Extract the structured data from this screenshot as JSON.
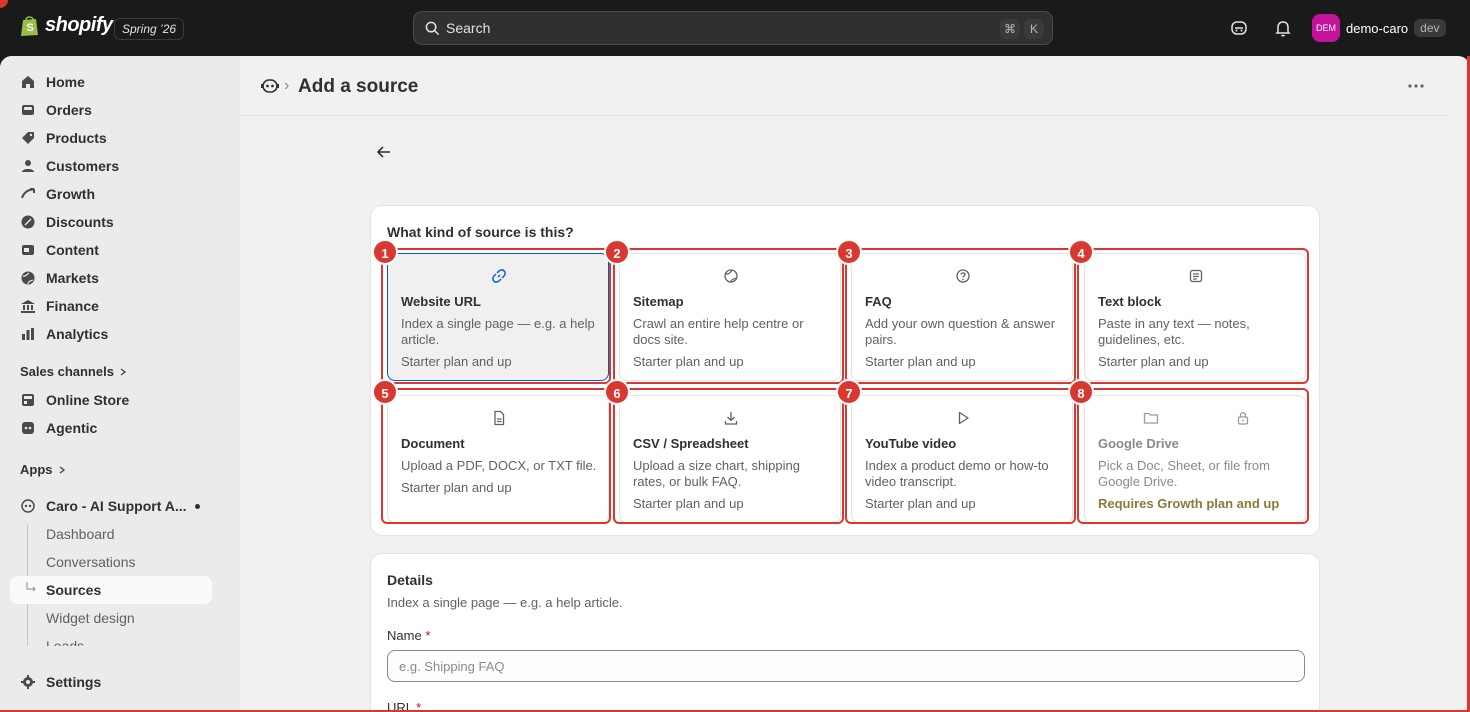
{
  "topbar": {
    "logo_text": "shopify",
    "release_label": "Spring ’26",
    "search_placeholder": "Search",
    "shortcut_keys": [
      "⌘",
      "K"
    ],
    "avatar_initials": "DEM",
    "store_name": "demo-caro",
    "env_badge": "dev"
  },
  "sidebar": {
    "items": [
      {
        "label": "Home",
        "icon": "home-icon"
      },
      {
        "label": "Orders",
        "icon": "inbox-icon"
      },
      {
        "label": "Products",
        "icon": "tag-icon"
      },
      {
        "label": "Customers",
        "icon": "person-icon"
      },
      {
        "label": "Growth",
        "icon": "growth-icon"
      },
      {
        "label": "Discounts",
        "icon": "discount-icon"
      },
      {
        "label": "Content",
        "icon": "content-icon"
      },
      {
        "label": "Markets",
        "icon": "globe-icon"
      },
      {
        "label": "Finance",
        "icon": "bank-icon"
      },
      {
        "label": "Analytics",
        "icon": "bar-chart-icon"
      }
    ],
    "sales_channels_label": "Sales channels",
    "channels": [
      {
        "label": "Online Store",
        "icon": "store-icon"
      },
      {
        "label": "Agentic",
        "icon": "agentic-icon"
      }
    ],
    "apps_label": "Apps",
    "app_name": "Caro - AI Support A...",
    "app_subitems": [
      "Dashboard",
      "Conversations",
      "Sources",
      "Widget design",
      "Leads"
    ],
    "active_subitem": "Sources",
    "settings_label": "Settings"
  },
  "header": {
    "title": "Add a source",
    "crumb_separator": "›"
  },
  "source_picker": {
    "title": "What kind of source is this?",
    "options": [
      {
        "title": "Website URL",
        "desc": "Index a single page — e.g. a help article.",
        "plan": "Starter plan and up",
        "icon": "link-icon",
        "selected": true
      },
      {
        "title": "Sitemap",
        "desc": "Crawl an entire help centre or docs site.",
        "plan": "Starter plan and up",
        "icon": "globe-icon"
      },
      {
        "title": "FAQ",
        "desc": "Add your own question & answer pairs.",
        "plan": "Starter plan and up",
        "icon": "question-circle-icon"
      },
      {
        "title": "Text block",
        "desc": "Paste in any text — notes, guidelines, etc.",
        "plan": "Starter plan and up",
        "icon": "note-icon"
      },
      {
        "title": "Document",
        "desc": "Upload a PDF, DOCX, or TXT file.",
        "plan": "Starter plan and up",
        "icon": "file-icon"
      },
      {
        "title": "CSV / Spreadsheet",
        "desc": "Upload a size chart, shipping rates, or bulk FAQ.",
        "plan": "Starter plan and up",
        "icon": "download-icon"
      },
      {
        "title": "YouTube video",
        "desc": "Index a product demo or how-to video transcript.",
        "plan": "Starter plan and up",
        "icon": "play-icon"
      },
      {
        "title": "Google Drive",
        "desc": "Pick a Doc, Sheet, or file from Google Drive.",
        "plan": "Requires Growth plan and up",
        "icon": "folder-icon",
        "locked": true
      }
    ],
    "badges": [
      "1",
      "2",
      "3",
      "4",
      "5",
      "6",
      "7",
      "8"
    ]
  },
  "details": {
    "title": "Details",
    "subtitle": "Index a single page — e.g. a help article.",
    "name_label": "Name",
    "required_mark": "*",
    "name_placeholder": "e.g. Shipping FAQ",
    "url_label": "URL"
  },
  "colors": {
    "accent": "#005bd3",
    "annotation_red": "#d8382f",
    "topbar_bg": "#1a1a1a",
    "locked_text": "#8a7a3c"
  }
}
